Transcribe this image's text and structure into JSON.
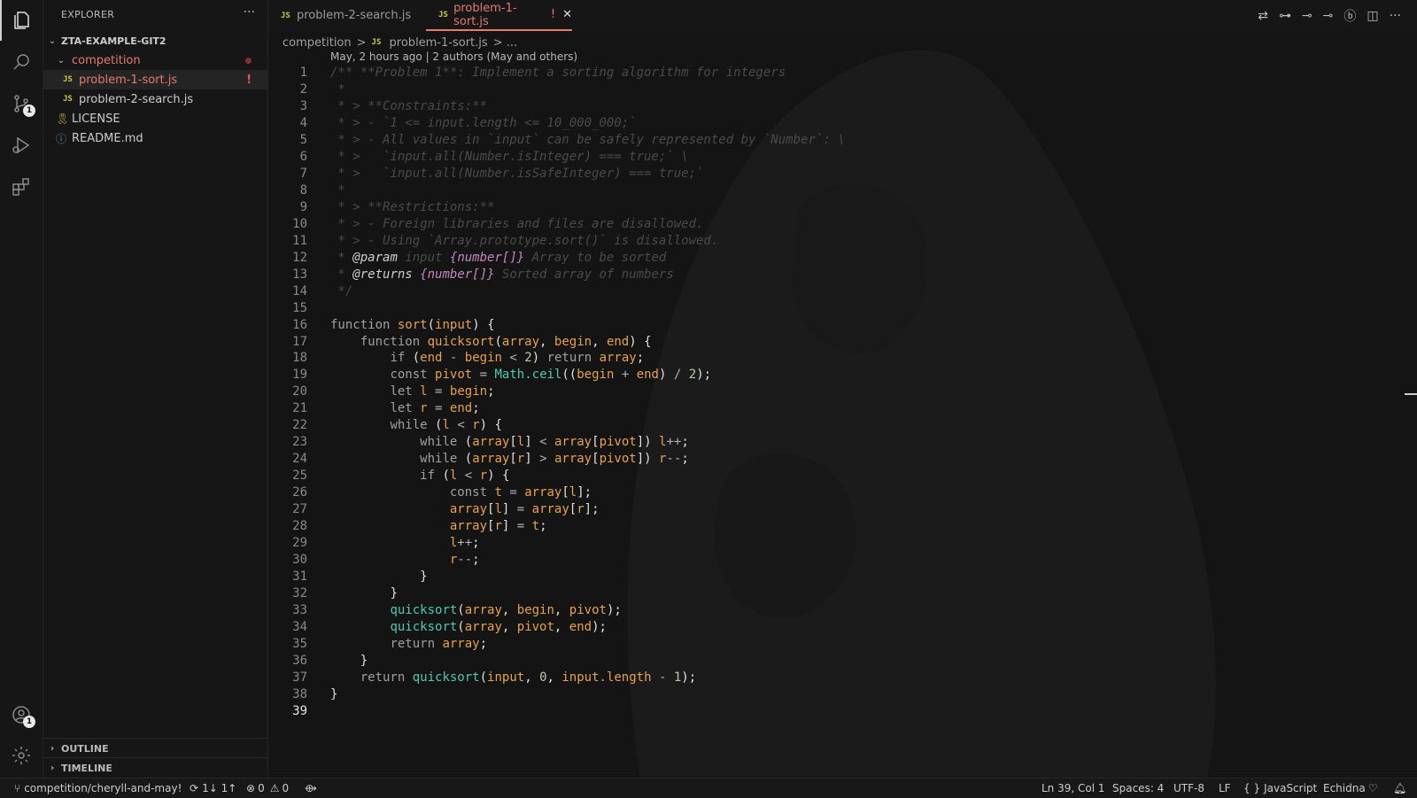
{
  "activity_bar": {
    "items": [
      "files-icon",
      "search-icon",
      "source-control-icon",
      "run-debug-icon",
      "extensions-icon"
    ],
    "scm_badge": "1",
    "accounts_badge": "1"
  },
  "sidebar": {
    "title": "EXPLORER",
    "more": "···",
    "root": "ZTA-EXAMPLE-GIT2",
    "folder": "competition",
    "files": [
      {
        "name": "problem-1-sort.js",
        "status": "!"
      },
      {
        "name": "problem-2-search.js"
      }
    ],
    "root_files": [
      "LICENSE",
      "README.md"
    ],
    "outline": "OUTLINE",
    "timeline": "TIMELINE"
  },
  "tabs": [
    {
      "label": "problem-2-search.js",
      "icon": "JS"
    },
    {
      "label": "problem-1-sort.js",
      "icon": "JS",
      "modified": "!",
      "close": "✕"
    }
  ],
  "breadcrumb": {
    "folder": "competition",
    "sep": ">",
    "file": "problem-1-sort.js",
    "more": "> ..."
  },
  "blame": "May, 2 hours ago | 2 authors (May and others)",
  "code_lines": [
    "/** **Problem 1**: Implement a sorting algorithm for integers",
    " *",
    " * > **Constraints:**",
    " * > - `1 <= input.length <= 10_000_000;`",
    " * > - All values in `input` can be safely represented by `Number`: \\",
    " * >   `input.all(Number.isInteger) === true;` \\",
    " * >   `input.all(Number.isSafeInteger) === true;`",
    " *",
    " * > **Restrictions:**",
    " * > - Foreign libraries and files are disallowed.",
    " * > - Using `Array.prototype.sort()` is disallowed.",
    " * @param input {number[]} Array to be sorted",
    " * @returns {number[]} Sorted array of numbers",
    " */",
    "",
    "function sort(input) {",
    "    function quicksort(array, begin, end) {",
    "        if (end - begin < 2) return array;",
    "        const pivot = Math.ceil((begin + end) / 2);",
    "        let l = begin;",
    "        let r = end;",
    "        while (l < r) {",
    "            while (array[l] < array[pivot]) l++;",
    "            while (array[r] > array[pivot]) r--;",
    "            if (l < r) {",
    "                const t = array[l];",
    "                array[l] = array[r];",
    "                array[r] = t;",
    "                l++;",
    "                r--;",
    "            }",
    "        }",
    "        quicksort(array, begin, pivot);",
    "        quicksort(array, pivot, end);",
    "        return array;",
    "    }",
    "    return quicksort(input, 0, input.length - 1);",
    "}",
    ""
  ],
  "cursor_line": 39,
  "status_bar": {
    "branch": "competition/cheryll-and-may!",
    "sync": "1↓ 1↑",
    "errors": "0",
    "warnings": "0",
    "position": "Ln 39, Col 1",
    "spaces": "Spaces: 4",
    "encoding": "UTF-8",
    "eol": "LF",
    "language": "JavaScript",
    "theme": "Echidna"
  },
  "colors": {
    "accent": "#e57a6e",
    "js": "#cbcb41",
    "background": "#141414"
  }
}
